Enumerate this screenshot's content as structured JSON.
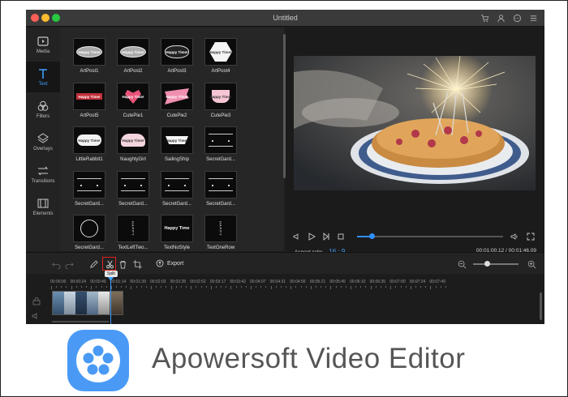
{
  "window": {
    "title": "Untitled"
  },
  "titlebar_icons": [
    "cart-icon",
    "user-icon",
    "chat-icon",
    "menu-icon"
  ],
  "sidebar": {
    "items": [
      {
        "label": "Media",
        "icon": "film-icon",
        "active": false
      },
      {
        "label": "Text",
        "icon": "text-t-icon",
        "active": true
      },
      {
        "label": "Filters",
        "icon": "filters-icon",
        "active": false
      },
      {
        "label": "Overlays",
        "icon": "overlays-icon",
        "active": false
      },
      {
        "label": "Transitions",
        "icon": "transitions-icon",
        "active": false
      },
      {
        "label": "Elements",
        "icon": "elements-icon",
        "active": false
      }
    ]
  },
  "library": {
    "tiles": [
      {
        "label": "ArtPost1",
        "badge": "Happy Time!"
      },
      {
        "label": "ArtPost2",
        "badge": "Happy Time!"
      },
      {
        "label": "ArtPost3",
        "badge": "Happy Time!"
      },
      {
        "label": "ArtPost4",
        "badge": "Happy Time!"
      },
      {
        "label": "ArtPost5",
        "badge": "Happy Time!"
      },
      {
        "label": "CutePie1",
        "badge": "Happy Time!"
      },
      {
        "label": "CutePie2",
        "badge": "Happy Time!"
      },
      {
        "label": "CutePie3",
        "badge": "Happy Time!"
      },
      {
        "label": "LittleRabbit1",
        "badge": "Happy Time!"
      },
      {
        "label": "NaughtyGirl",
        "badge": "Happy Time!"
      },
      {
        "label": "SailingShip",
        "badge": "Happy Time!"
      },
      {
        "label": "SecretGard...",
        "badge": ""
      },
      {
        "label": "SecretGard...",
        "badge": ""
      },
      {
        "label": "SecretGard...",
        "badge": ""
      },
      {
        "label": "SecretGard...",
        "badge": ""
      },
      {
        "label": "SecretGard...",
        "badge": ""
      },
      {
        "label": "SecretGard...",
        "badge": ""
      },
      {
        "label": "TextLeftTwo...",
        "badge": "HAPPY"
      },
      {
        "label": "TextNoStyle",
        "badge": "Happy Time"
      },
      {
        "label": "TextOneRow",
        "badge": "HAPPY"
      }
    ]
  },
  "player": {
    "aspect_label": "Aspect ratio",
    "aspect_value": "16 : 9",
    "time": "00:01:00.12 / 00:01:46.09",
    "progress": 0.1
  },
  "toolbar": {
    "export_label": "Export",
    "split_tooltip": "Split",
    "zoom_level": 0.3
  },
  "timeline": {
    "ticks": [
      "00:00:00",
      "00:00:24",
      "00:00:49",
      "00:01:14",
      "00:01:39",
      "00:02:03",
      "00:02:28",
      "00:02:52",
      "00:03:17",
      "00:03:42",
      "00:04:07",
      "00:04:31",
      "00:04:56",
      "00:05:21",
      "00:05:45",
      "00:06:10",
      "00:06:35",
      "00:07:00",
      "00:07:24",
      "00:07:49"
    ]
  },
  "brand": {
    "name": "Apowersoft Video Editor"
  },
  "colors": {
    "accent": "#3ea0ff",
    "highlight": "#e02020",
    "logo_bg": "#4a9af5"
  }
}
